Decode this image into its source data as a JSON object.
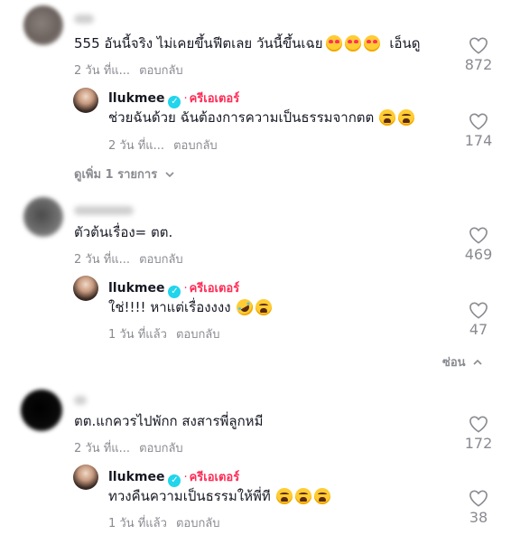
{
  "comments": [
    {
      "text": "555 อันนี้จริง ไม่เคยขึ้นฟีตเลย วันนี้ขึ้นเฉย",
      "suffix": "เอ็นดู",
      "time": "2 วัน ที่แ...",
      "reply_label": "ตอบกลับ",
      "likes": "872",
      "view_more": "ดูเพิ่ม 1 รายการ",
      "reply": {
        "username": "llukmee",
        "badge": "ครีเอเตอร์",
        "text": "ช่วยฉันด้วย ฉันต้องการความเป็นธรรมจากตต",
        "time": "2 วัน ที่แ...",
        "reply_label": "ตอบกลับ",
        "likes": "174"
      }
    },
    {
      "text": "ตัวต้นเรื่อง= ตต.",
      "time": "2 วัน ที่แ...",
      "reply_label": "ตอบกลับ",
      "likes": "469",
      "hide_label": "ซ่อน",
      "reply": {
        "username": "llukmee",
        "badge": "ครีเอเตอร์",
        "text": "ใช่!!!! หาแต่เรื่องงงง",
        "time": "1 วัน ที่แล้ว",
        "reply_label": "ตอบกลับ",
        "likes": "47"
      }
    },
    {
      "text": "ตต.แกควรไปพักก สงสารพี่ลูกหมี",
      "time": "2 วัน ที่แ...",
      "reply_label": "ตอบกลับ",
      "likes": "172",
      "reply": {
        "username": "llukmee",
        "badge": "ครีเอเตอร์",
        "text": "ทวงคืนความเป็นธรรมให้พี่ที",
        "time": "1 วัน ที่แล้ว",
        "reply_label": "ตอบกลับ",
        "likes": "38"
      }
    }
  ],
  "icons": {
    "like": "heart-outline-icon",
    "verified": "verified-check-icon",
    "chevron": "chevron-down-icon"
  },
  "colors": {
    "creator_badge": "#fe2c55",
    "verified": "#20d5ec",
    "meta": "#8a8b91"
  }
}
